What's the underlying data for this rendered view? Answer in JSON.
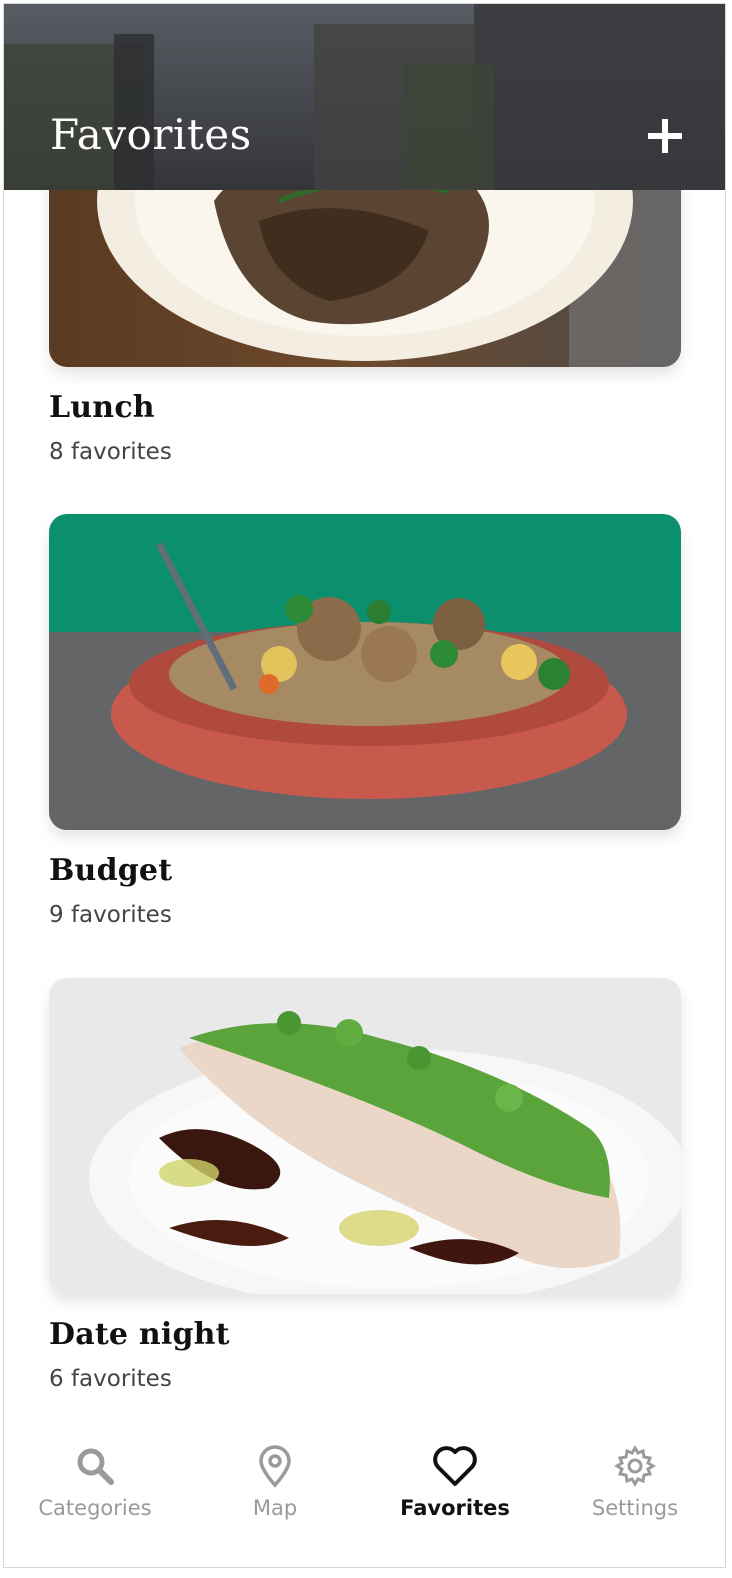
{
  "header": {
    "title": "Favorites",
    "add_icon": "plus-icon"
  },
  "cards": [
    {
      "title": "Lunch",
      "count": "8 favorites"
    },
    {
      "title": "Budget",
      "count": "9 favorites"
    },
    {
      "title": "Date night",
      "count": "6 favorites"
    }
  ],
  "tabbar": {
    "tabs": [
      {
        "label": "Categories",
        "icon": "search-icon",
        "active": false
      },
      {
        "label": "Map",
        "icon": "map-pin-icon",
        "active": false
      },
      {
        "label": "Favorites",
        "icon": "heart-icon",
        "active": true
      },
      {
        "label": "Settings",
        "icon": "gear-icon",
        "active": false
      }
    ]
  },
  "colors": {
    "active_tab": "#111111",
    "inactive_tab": "#9a9a9a",
    "header_overlay": "#2a2a2e"
  }
}
